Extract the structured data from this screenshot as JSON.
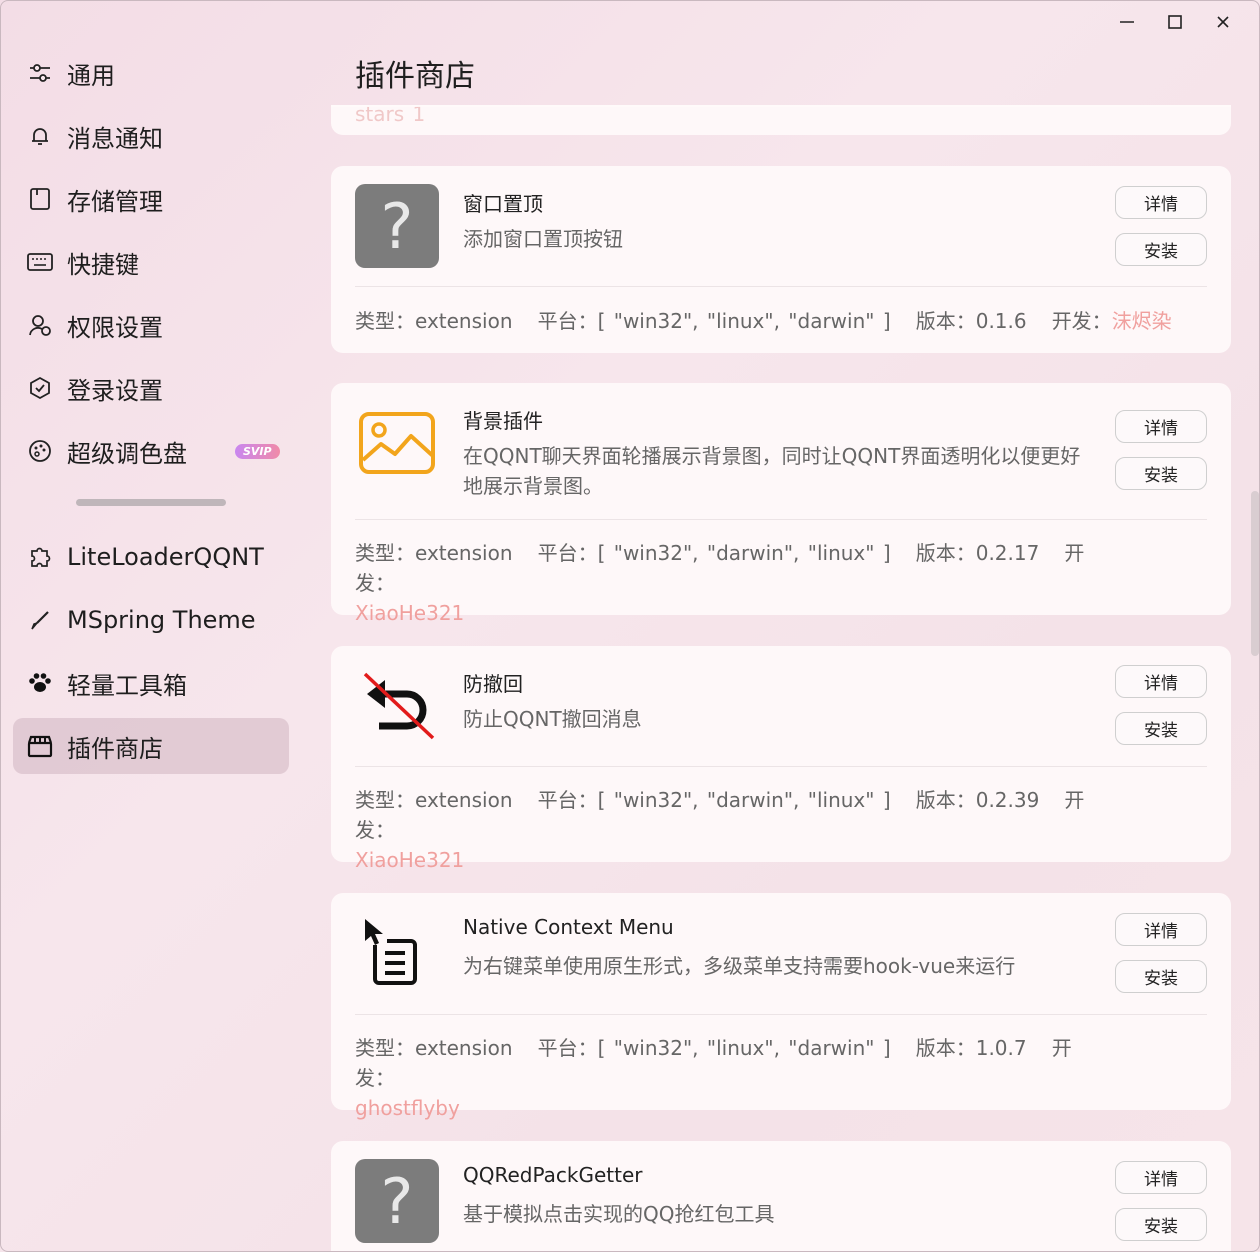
{
  "window_controls": {
    "minimize": "—",
    "maximize": "☐",
    "close": "✕"
  },
  "sidebar": {
    "items": [
      {
        "label": "通用",
        "icon": "sliders-icon"
      },
      {
        "label": "消息通知",
        "icon": "bell-icon"
      },
      {
        "label": "存储管理",
        "icon": "folder-icon"
      },
      {
        "label": "快捷键",
        "icon": "keyboard-icon"
      },
      {
        "label": "权限设置",
        "icon": "user-lock-icon"
      },
      {
        "label": "登录设置",
        "icon": "shield-icon"
      },
      {
        "label": "超级调色盘",
        "icon": "palette-icon",
        "badge": "SVIP"
      },
      {
        "label": "LiteLoaderQQNT",
        "icon": "puzzle-icon"
      },
      {
        "label": "MSpring Theme",
        "icon": "brush-icon"
      },
      {
        "label": "轻量工具箱",
        "icon": "paw-icon"
      },
      {
        "label": "插件商店",
        "icon": "store-icon",
        "active": true
      }
    ]
  },
  "header": {
    "title": "插件商店"
  },
  "prev_card_partial": "stars 1",
  "buttons": {
    "details": "详情",
    "install": "安装"
  },
  "meta_labels": {
    "type": "类型：",
    "platform": "平台：",
    "version": "版本：",
    "dev": "开发："
  },
  "plugins": [
    {
      "name": "窗口置顶",
      "desc": "添加窗口置顶按钮",
      "type": "extension",
      "platform": "[ \"win32\", \"linux\", \"darwin\" ]",
      "version": "0.1.6",
      "dev": "沫烬染",
      "icon": "question-icon"
    },
    {
      "name": "背景插件",
      "desc": "在QQNT聊天界面轮播展示背景图，同时让QQNT界面透明化以便更好地展示背景图。",
      "type": "extension",
      "platform": "[ \"win32\", \"darwin\", \"linux\" ]",
      "version": "0.2.17",
      "dev": "XiaoHe321",
      "icon": "image-icon"
    },
    {
      "name": "防撤回",
      "desc": "防止QQNT撤回消息",
      "type": "extension",
      "platform": "[ \"win32\", \"darwin\", \"linux\" ]",
      "version": "0.2.39",
      "dev": "XiaoHe321",
      "icon": "no-undo-icon"
    },
    {
      "name": "Native Context Menu",
      "desc": "为右键菜单使用原生形式，多级菜单支持需要hook-vue来运行",
      "type": "extension",
      "platform": "[ \"win32\", \"linux\", \"darwin\" ]",
      "version": "1.0.7",
      "dev": "ghostflyby",
      "icon": "context-menu-icon"
    },
    {
      "name": "QQRedPackGetter",
      "desc": "基于模拟点击实现的QQ抢红包工具",
      "icon": "question-icon"
    }
  ]
}
